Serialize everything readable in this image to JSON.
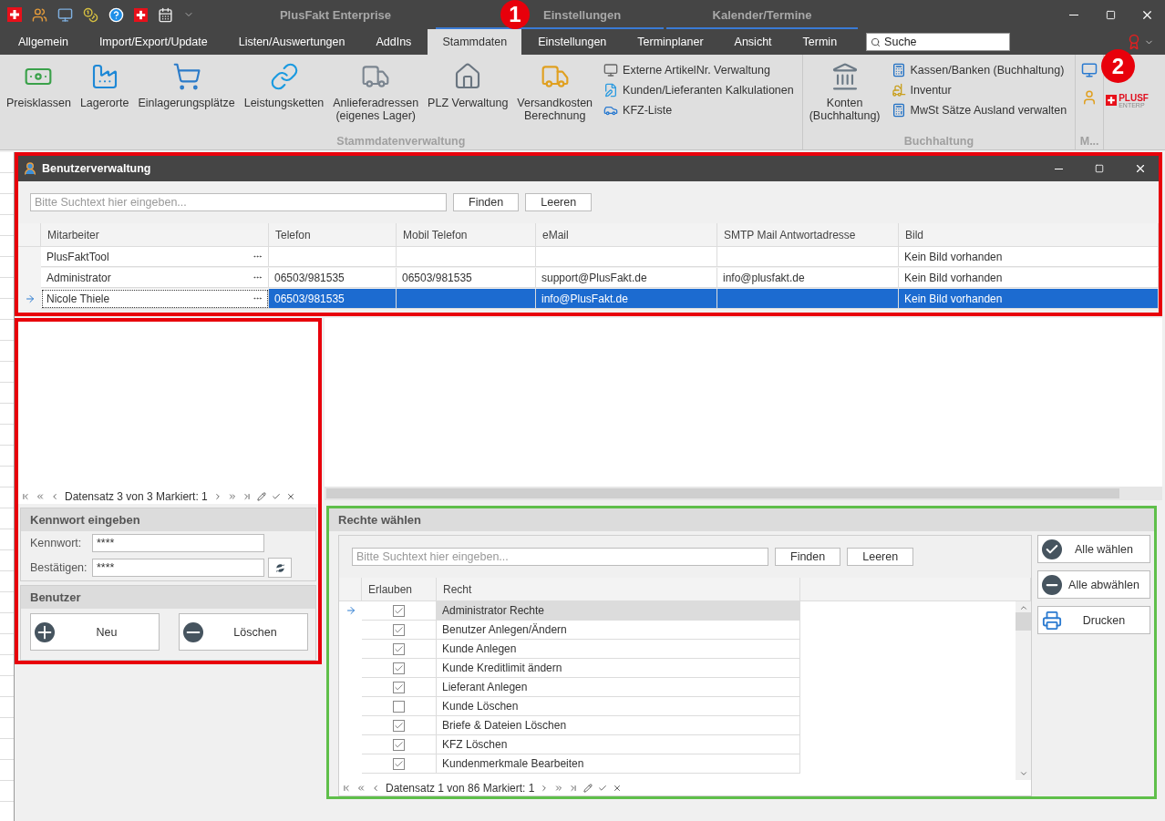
{
  "window": {
    "title": "PlusFakt Enterprise"
  },
  "context_groups": [
    {
      "label": "Einstellungen"
    },
    {
      "label": "Kalender/Termine"
    }
  ],
  "tabs": [
    {
      "label": "Allgemein",
      "selected": false
    },
    {
      "label": "Import/Export/Update",
      "selected": false
    },
    {
      "label": "Listen/Auswertungen",
      "selected": false
    },
    {
      "label": "AddIns",
      "selected": false
    },
    {
      "label": "Stammdaten",
      "selected": true
    },
    {
      "label": "Einstellungen",
      "selected": false
    },
    {
      "label": "Terminplaner",
      "selected": false
    },
    {
      "label": "Ansicht",
      "selected": false
    },
    {
      "label": "Termin",
      "selected": false
    }
  ],
  "search": {
    "placeholder": "Suche"
  },
  "ribbon": {
    "groups": [
      {
        "title": "Stammdatenverwaltung",
        "large": [
          "Preisklassen",
          "Lagerorte",
          "Einlagerungsplätze",
          "Leistungsketten",
          "Anlieferadressen\n(eigenes Lager)",
          "PLZ Verwaltung",
          "Versandkosten\nBerechnung"
        ],
        "small": [
          "Externe ArtikelNr. Verwaltung",
          "Kunden/Lieferanten Kalkulationen",
          "KFZ-Liste"
        ]
      },
      {
        "title": "Buchhaltung",
        "large": [
          "Konten\n(Buchhaltung)"
        ],
        "small": [
          "Kassen/Banken (Buchhaltung)",
          "Inventur",
          "MwSt Sätze Ausland verwalten"
        ]
      },
      {
        "title": "M..."
      }
    ],
    "logo": {
      "text": "PLUSF",
      "subtext": "ENTERP"
    }
  },
  "user_window": {
    "title": "Benutzerverwaltung",
    "search": {
      "placeholder": "Bitte Suchtext hier eingeben...",
      "buttons": [
        "Finden",
        "Leeren"
      ]
    },
    "columns": [
      "Mitarbeiter",
      "Telefon",
      "Mobil Telefon",
      "eMail",
      "SMTP Mail Antwortadresse",
      "Bild"
    ],
    "rows": [
      {
        "cells": [
          "PlusFaktTool",
          null,
          null,
          null,
          null,
          "Kein Bild vorhanden"
        ],
        "selected": false
      },
      {
        "cells": [
          "Administrator",
          "06503/981535",
          "06503/981535",
          "support@PlusFakt.de",
          "info@plusfakt.de",
          "Kein Bild vorhanden"
        ],
        "selected": false
      },
      {
        "cells": [
          "Nicole Thiele",
          "06503/981535",
          null,
          "info@PlusFakt.de",
          null,
          "Kein Bild vorhanden"
        ],
        "selected": true
      }
    ]
  },
  "left_panel": {
    "nav": "Datensatz 3 von 3 Markiert: 1",
    "password_group": {
      "title": "Kennwort eingeben",
      "fields": [
        {
          "label": "Kennwort:",
          "value": "****"
        },
        {
          "label": "Bestätigen:",
          "value": "****"
        }
      ]
    },
    "user_group": {
      "title": "Benutzer",
      "buttons": [
        "Neu",
        "Löschen"
      ]
    }
  },
  "rights": {
    "title": "Rechte wählen",
    "search": {
      "placeholder": "Bitte Suchtext hier eingeben...",
      "buttons": [
        "Finden",
        "Leeren"
      ]
    },
    "columns": [
      "Erlauben",
      "Recht"
    ],
    "rows": [
      {
        "label": "Administrator Rechte",
        "checked": true,
        "selected": true
      },
      {
        "label": "Benutzer Anlegen/Ändern",
        "checked": true,
        "selected": false
      },
      {
        "label": "Kunde Anlegen",
        "checked": true,
        "selected": false
      },
      {
        "label": "Kunde Kreditlimit ändern",
        "checked": true,
        "selected": false
      },
      {
        "label": "Lieferant Anlegen",
        "checked": true,
        "selected": false
      },
      {
        "label": "Kunde Löschen",
        "checked": false,
        "selected": false
      },
      {
        "label": "Briefe & Dateien Löschen",
        "checked": true,
        "selected": false
      },
      {
        "label": "KFZ Löschen",
        "checked": true,
        "selected": false
      },
      {
        "label": "Kundenmerkmale Bearbeiten",
        "checked": true,
        "selected": false
      }
    ],
    "nav": "Datensatz 1 von 86 Markiert: 1",
    "buttons": [
      "Alle wählen",
      "Alle abwählen",
      "Drucken"
    ]
  },
  "callouts": [
    {
      "label": "1"
    },
    {
      "label": "2"
    }
  ],
  "highlight_frames": [
    {
      "color": "#e8000b"
    },
    {
      "color": "#e8000b"
    },
    {
      "color": "#5fbf4a"
    }
  ]
}
